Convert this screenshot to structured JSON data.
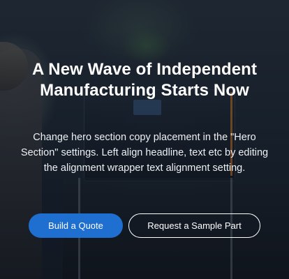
{
  "hero": {
    "headline": "A New Wave of Independent Manufacturing Starts Now",
    "body": "Change hero section copy placement in the \"Hero Section\" settings. Left align headline, text etc by editing the alignment wrapper text alignment setting.",
    "primary_button_label": "Build a Quote",
    "secondary_button_label": "Request a Sample Part"
  },
  "colors": {
    "primary_button": "#1e6fd0",
    "text": "#ffffff"
  }
}
